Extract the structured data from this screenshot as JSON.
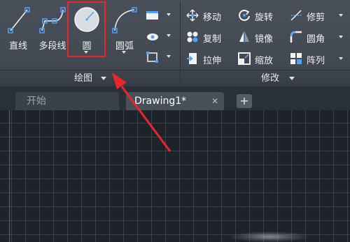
{
  "ribbon": {
    "draw_panel": {
      "title": "绘图",
      "line_label": "直线",
      "polyline_label": "多段线",
      "circle_label": "圆",
      "arc_label": "圆弧"
    },
    "modify_panel": {
      "title": "修改",
      "move_label": "移动",
      "rotate_label": "旋转",
      "trim_label": "修剪",
      "copy_label": "复制",
      "mirror_label": "镜像",
      "fillet_label": "圆角",
      "stretch_label": "拉伸",
      "scale_label": "缩放",
      "array_label": "阵列"
    }
  },
  "tabs": {
    "start_label": "开始",
    "drawing_label": "Drawing1*",
    "close_glyph": "✕",
    "add_glyph": "+"
  },
  "colors": {
    "highlight": "#e8262c",
    "ribbon_bg": "#434952",
    "canvas_bg": "#1e232a",
    "icon_blue": "#4da3ff"
  }
}
